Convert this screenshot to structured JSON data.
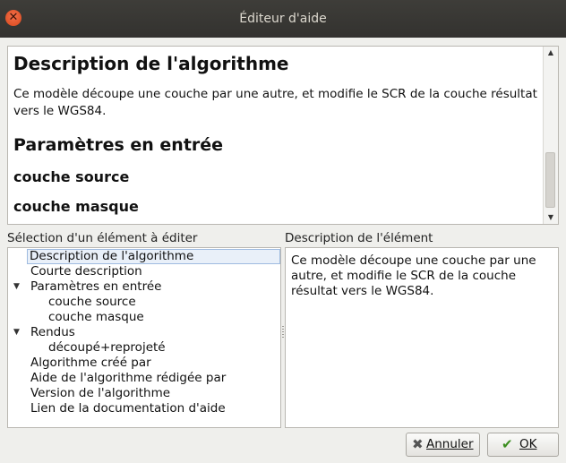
{
  "window": {
    "title": "Éditeur d'aide"
  },
  "preview": {
    "heading1": "Description de l'algorithme",
    "paragraph": "Ce modèle découpe une couche par une autre, et modifie le SCR de la couche résultat vers le WGS84.",
    "heading2": "Paramètres en entrée",
    "params": [
      "couche source",
      "couche masque"
    ]
  },
  "tree": {
    "label": "Sélection d'un élément à éditer",
    "items": [
      {
        "label": "Description de l'algorithme",
        "level": 0,
        "selected": true
      },
      {
        "label": "Courte description",
        "level": 0
      },
      {
        "label": "Paramètres en entrée",
        "level": 0,
        "expanded": true
      },
      {
        "label": "couche source",
        "level": 1
      },
      {
        "label": "couche masque",
        "level": 1
      },
      {
        "label": "Rendus",
        "level": 0,
        "expanded": true
      },
      {
        "label": "découpé+reprojeté",
        "level": 1
      },
      {
        "label": "Algorithme créé par",
        "level": 0
      },
      {
        "label": "Aide de l'algorithme rédigée par",
        "level": 0
      },
      {
        "label": "Version de l'algorithme",
        "level": 0
      },
      {
        "label": "Lien de la documentation d'aide",
        "level": 0
      }
    ]
  },
  "description": {
    "label": "Description de l'élément",
    "text": "Ce modèle découpe une couche par une autre, et modifie le SCR de la couche résultat vers le WGS84."
  },
  "buttons": {
    "cancel": "Annuler",
    "ok": "OK"
  },
  "colors": {
    "close": "#e95420",
    "ok_icon": "#3a8d1e",
    "cancel_icon": "#555555",
    "selection": "#e9f0f9"
  }
}
